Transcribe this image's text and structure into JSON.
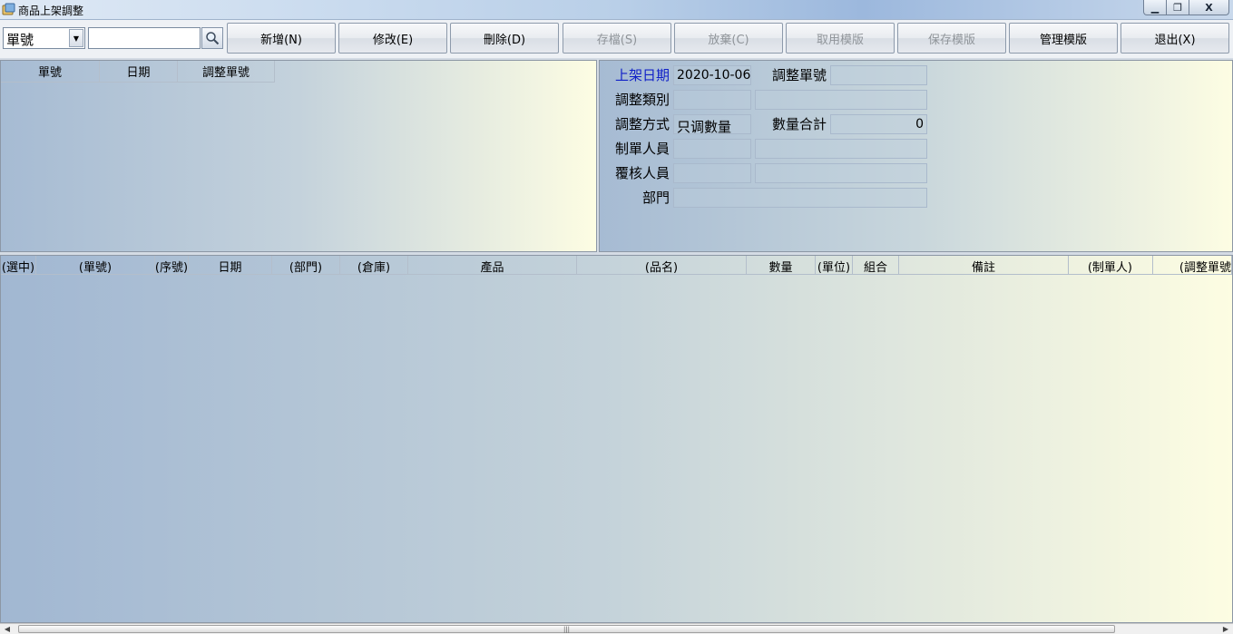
{
  "window": {
    "title": "商品上架調整",
    "minimize_glyph": "▁",
    "maximize_glyph": "❐",
    "close_glyph": "X"
  },
  "toolbar": {
    "search_field_selected": "單號",
    "search_value": "",
    "buttons": {
      "new": "新增(N)",
      "edit": "修改(E)",
      "delete": "刪除(D)",
      "save": "存檔(S)",
      "discard": "放棄(C)",
      "use_template": "取用模版",
      "save_template": "保存模版",
      "manage_template": "管理模版",
      "exit": "退出(X)"
    }
  },
  "list_grid": {
    "columns": [
      "單號",
      "日期",
      "調整單號"
    ],
    "rows": []
  },
  "form": {
    "listing_date_label": "上架日期",
    "listing_date_value": "2020-10-06",
    "adjust_no_label": "調整單號",
    "adjust_no_value": "",
    "adjust_type_label": "調整類別",
    "adjust_type_code": "",
    "adjust_type_name": "",
    "adjust_method_label": "調整方式",
    "adjust_method_value": "只调數量",
    "qty_total_label": "數量合計",
    "qty_total_value": "0",
    "creator_label": "制單人員",
    "creator_code": "",
    "creator_name": "",
    "reviewer_label": "覆核人員",
    "reviewer_code": "",
    "reviewer_name": "",
    "department_label": "部門",
    "department_value": ""
  },
  "detail_grid": {
    "columns": [
      "(選中)",
      "(單號)",
      "(序號)",
      "日期",
      "(部門)",
      "(倉庫)",
      "產品",
      "(品名)",
      "數量",
      "(單位)",
      "組合",
      "備註",
      "(制單人)",
      "(調整單號"
    ],
    "rows": []
  },
  "colors": {
    "accent_label": "#1020c8",
    "disabled_text": "#8f9499"
  }
}
